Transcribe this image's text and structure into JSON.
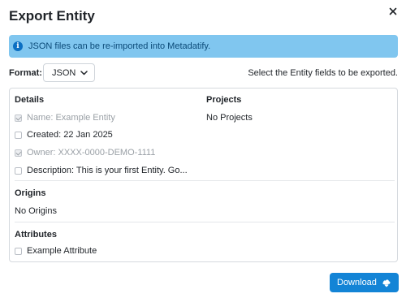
{
  "dialog": {
    "title": "Export Entity",
    "close_icon": "close-icon"
  },
  "banner": {
    "icon": "info-icon",
    "message": "JSON files can be re-imported into Metadatify.",
    "color": "#80c6ef"
  },
  "format": {
    "label": "Format:",
    "selected": "JSON"
  },
  "hint": "Select the Entity fields to be exported.",
  "details": {
    "heading": "Details",
    "fields": [
      {
        "label": "Name: Example Entity",
        "checked": true,
        "disabled": true
      },
      {
        "label": "Created: 22 Jan 2025",
        "checked": false,
        "disabled": false
      },
      {
        "label": "Owner: XXXX-0000-DEMO-1111",
        "checked": true,
        "disabled": true
      },
      {
        "label": "Description: This is your first Entity. Go...",
        "checked": false,
        "disabled": false
      }
    ]
  },
  "projects": {
    "heading": "Projects",
    "empty": "No Projects"
  },
  "origins": {
    "heading": "Origins",
    "empty": "No Origins"
  },
  "attributes": {
    "heading": "Attributes",
    "items": [
      {
        "label": "Example Attribute",
        "checked": false
      }
    ]
  },
  "download": {
    "label": "Download",
    "icon": "cloud-download-icon",
    "color": "#1384d6"
  }
}
